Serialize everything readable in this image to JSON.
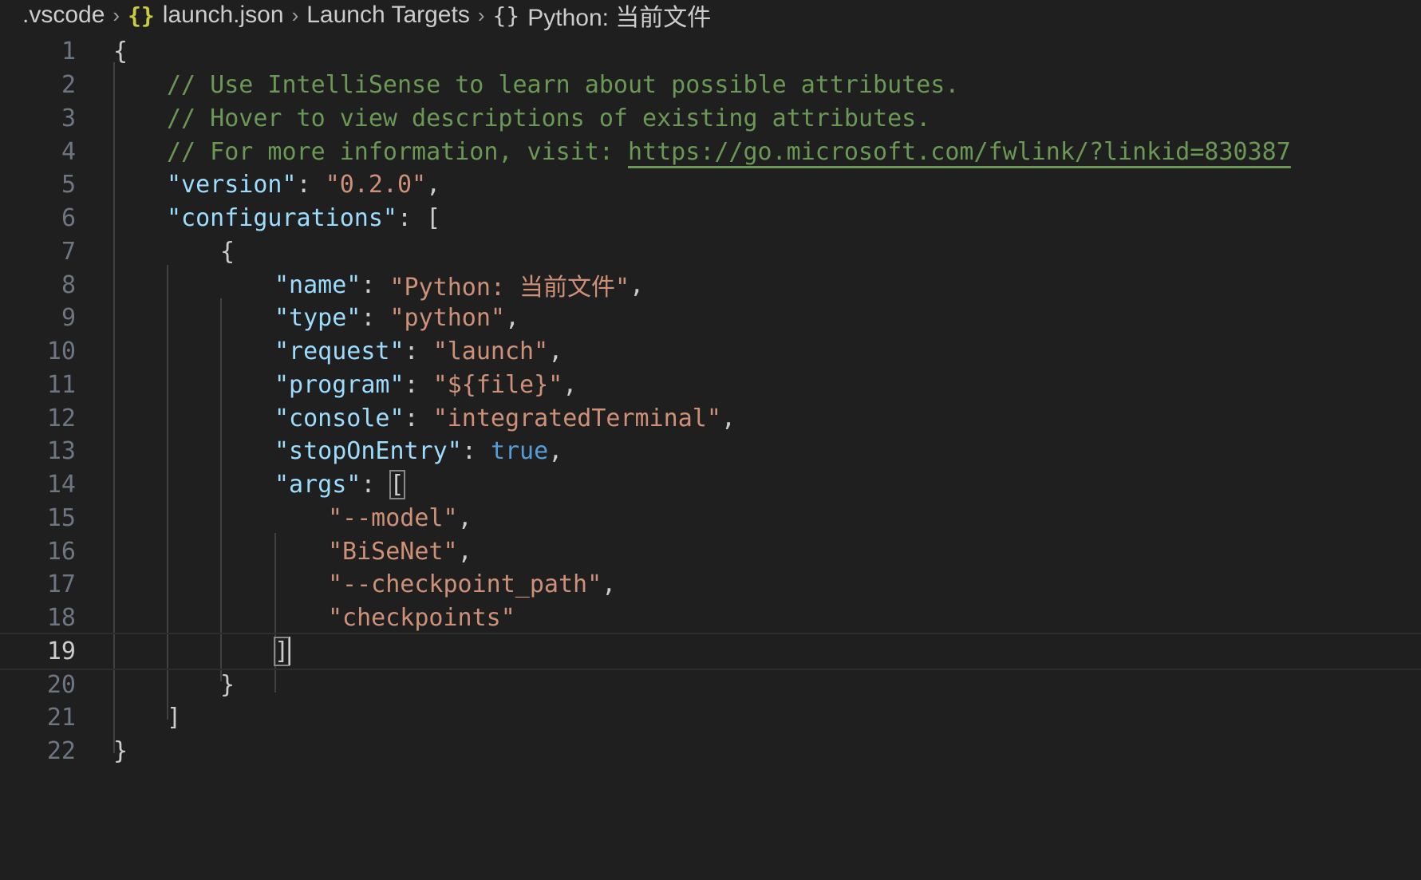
{
  "breadcrumb": {
    "folder": ".vscode",
    "file": "launch.json",
    "section": "Launch Targets",
    "item": "Python: 当前文件",
    "file_icon": "braces-icon",
    "item_icon": "braces-icon"
  },
  "editor": {
    "current_line": 19,
    "lines": [
      {
        "n": "1",
        "text": "{"
      },
      {
        "n": "2",
        "text": "// Use IntelliSense to learn about possible attributes."
      },
      {
        "n": "3",
        "text": "// Hover to view descriptions of existing attributes."
      },
      {
        "n": "4",
        "comment": "// For more information, visit: ",
        "link": "https://go.microsoft.com/fwlink/?linkid=830387"
      },
      {
        "n": "5",
        "key": "\"version\"",
        "sep": ": ",
        "value": "\"0.2.0\"",
        "end": ","
      },
      {
        "n": "6",
        "key": "\"configurations\"",
        "sep": ": ",
        "punct": "["
      },
      {
        "n": "7",
        "text": "{"
      },
      {
        "n": "8",
        "key": "\"name\"",
        "sep": ": ",
        "value": "\"Python: 当前文件\"",
        "end": ","
      },
      {
        "n": "9",
        "key": "\"type\"",
        "sep": ": ",
        "value": "\"python\"",
        "end": ","
      },
      {
        "n": "10",
        "key": "\"request\"",
        "sep": ": ",
        "value": "\"launch\"",
        "end": ","
      },
      {
        "n": "11",
        "key": "\"program\"",
        "sep": ": ",
        "value": "\"${file}\"",
        "end": ","
      },
      {
        "n": "12",
        "key": "\"console\"",
        "sep": ": ",
        "value": "\"integratedTerminal\"",
        "end": ","
      },
      {
        "n": "13",
        "key": "\"stopOnEntry\"",
        "sep": ": ",
        "bool": "true",
        "end": ","
      },
      {
        "n": "14",
        "key": "\"args\"",
        "sep": ": ",
        "punct": "["
      },
      {
        "n": "15",
        "value": "\"--model\"",
        "end": ","
      },
      {
        "n": "16",
        "value": "\"BiSeNet\"",
        "end": ","
      },
      {
        "n": "17",
        "value": "\"--checkpoint_path\"",
        "end": ","
      },
      {
        "n": "18",
        "value": "\"checkpoints\""
      },
      {
        "n": "19",
        "text": "]"
      },
      {
        "n": "20",
        "text": "}"
      },
      {
        "n": "21",
        "text": "]"
      },
      {
        "n": "22",
        "text": "}"
      }
    ]
  }
}
